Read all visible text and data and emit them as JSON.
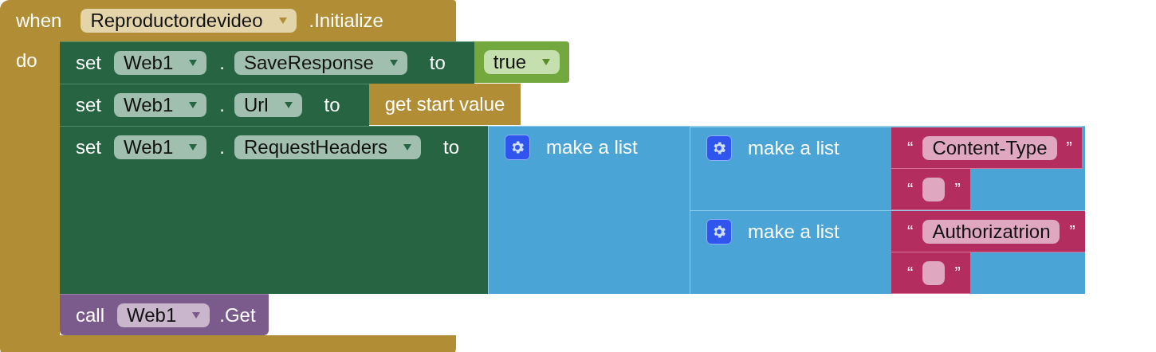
{
  "event": {
    "keyword": "when",
    "component": "Reproductordevideo",
    "event_name": ".Initialize",
    "do_label": "do",
    "statements": [
      {
        "kind": "set",
        "keyword": "set",
        "component": "Web1",
        "dot": ".",
        "property": "SaveResponse",
        "to": "to",
        "value": {
          "kind": "boolean",
          "value": "true"
        }
      },
      {
        "kind": "set",
        "keyword": "set",
        "component": "Web1",
        "dot": ".",
        "property": "Url",
        "to": "to",
        "value": {
          "kind": "get",
          "label": "get start value"
        }
      },
      {
        "kind": "set",
        "keyword": "set",
        "component": "Web1",
        "dot": ".",
        "property": "RequestHeaders",
        "to": "to",
        "value": {
          "kind": "list",
          "label": "make a list",
          "items": [
            {
              "kind": "list",
              "label": "make a list",
              "items": [
                {
                  "kind": "text",
                  "open_quote": "“",
                  "value": "Content-Type",
                  "close_quote": "”"
                },
                {
                  "kind": "text",
                  "open_quote": "“",
                  "close_quote": "”"
                }
              ]
            },
            {
              "kind": "list",
              "label": "make a list",
              "items": [
                {
                  "kind": "text",
                  "open_quote": "“",
                  "value": "Authorizatrion",
                  "close_quote": "”"
                },
                {
                  "kind": "text",
                  "open_quote": "“",
                  "close_quote": "”"
                }
              ]
            }
          ]
        }
      },
      {
        "kind": "call",
        "keyword": "call",
        "component": "Web1",
        "method": ".Get"
      }
    ]
  }
}
